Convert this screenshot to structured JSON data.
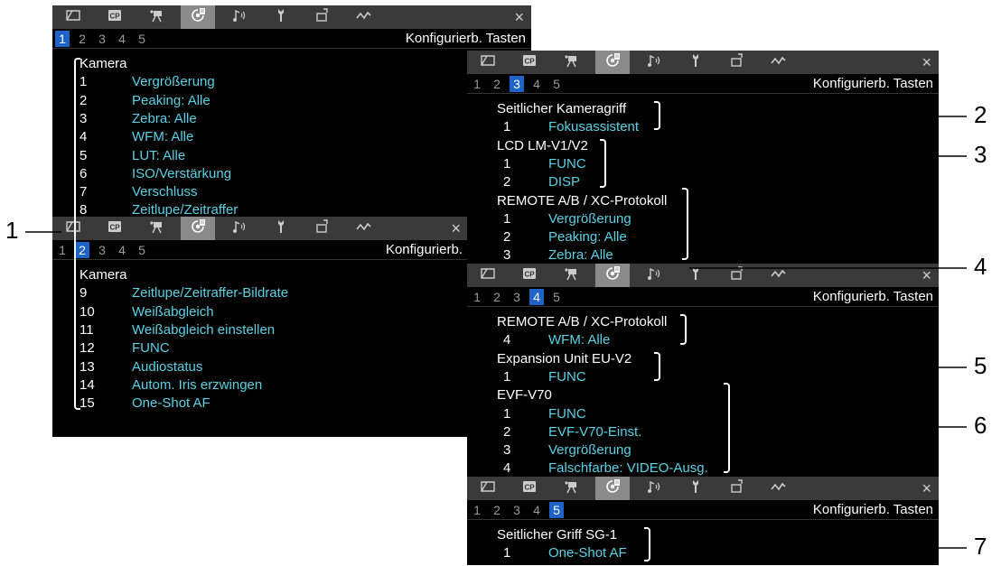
{
  "panels": [
    {
      "pages": [
        "1",
        "2",
        "3",
        "4",
        "5"
      ],
      "active_page": "1",
      "title": "Konfigurierb. Tasten",
      "groups": [
        {
          "name": "Kamera",
          "items": [
            {
              "num": "1",
              "label": "Vergrößerung"
            },
            {
              "num": "2",
              "label": "Peaking: Alle"
            },
            {
              "num": "3",
              "label": "Zebra: Alle"
            },
            {
              "num": "4",
              "label": "WFM: Alle"
            },
            {
              "num": "5",
              "label": "LUT: Alle"
            },
            {
              "num": "6",
              "label": "ISO/Verstärkung"
            },
            {
              "num": "7",
              "label": "Verschluss"
            },
            {
              "num": "8",
              "label": "Zeitlupe/Zeitraffer"
            }
          ]
        }
      ]
    },
    {
      "pages": [
        "1",
        "2",
        "3",
        "4",
        "5"
      ],
      "active_page": "2",
      "title": "Konfigurierb.",
      "groups": [
        {
          "name": "Kamera",
          "items": [
            {
              "num": "9",
              "label": "Zeitlupe/Zeitraffer-Bildrate"
            },
            {
              "num": "10",
              "label": "Weißabgleich"
            },
            {
              "num": "11",
              "label": "Weißabgleich einstellen"
            },
            {
              "num": "12",
              "label": "FUNC"
            },
            {
              "num": "13",
              "label": "Audiostatus"
            },
            {
              "num": "14",
              "label": "Autom. Iris erzwingen"
            },
            {
              "num": "15",
              "label": "One-Shot AF"
            }
          ]
        }
      ]
    },
    {
      "pages": [
        "1",
        "2",
        "3",
        "4",
        "5"
      ],
      "active_page": "3",
      "title": "Konfigurierb. Tasten",
      "groups": [
        {
          "name": "Seitlicher Kameragriff",
          "items": [
            {
              "num": "1",
              "label": "Fokusassistent"
            }
          ]
        },
        {
          "name": "LCD LM-V1/V2",
          "items": [
            {
              "num": "1",
              "label": "FUNC"
            },
            {
              "num": "2",
              "label": "DISP"
            }
          ]
        },
        {
          "name": "REMOTE A/B / XC-Protokoll",
          "items": [
            {
              "num": "1",
              "label": "Vergrößerung"
            },
            {
              "num": "2",
              "label": "Peaking: Alle"
            },
            {
              "num": "3",
              "label": "Zebra: Alle"
            }
          ]
        }
      ]
    },
    {
      "pages": [
        "1",
        "2",
        "3",
        "4",
        "5"
      ],
      "active_page": "4",
      "title": "Konfigurierb. Tasten",
      "groups": [
        {
          "name": "REMOTE A/B / XC-Protokoll",
          "items": [
            {
              "num": "4",
              "label": "WFM: Alle"
            }
          ]
        },
        {
          "name": "Expansion Unit EU-V2",
          "items": [
            {
              "num": "1",
              "label": "FUNC"
            }
          ]
        },
        {
          "name": "EVF-V70",
          "items": [
            {
              "num": "1",
              "label": "FUNC"
            },
            {
              "num": "2",
              "label": "EVF-V70-Einst."
            },
            {
              "num": "3",
              "label": "Vergrößerung"
            },
            {
              "num": "4",
              "label": "Falschfarbe: VIDEO-Ausg."
            }
          ]
        }
      ]
    },
    {
      "pages": [
        "1",
        "2",
        "3",
        "4",
        "5"
      ],
      "active_page": "5",
      "title": "Konfigurierb. Tasten",
      "groups": [
        {
          "name": "Seitlicher Griff SG-1",
          "items": [
            {
              "num": "1",
              "label": "One-Shot AF"
            }
          ]
        }
      ]
    }
  ],
  "tab_icons": [
    "lcd-screen-icon",
    "custom-picture-icon",
    "camera-recording-icon",
    "custom-function-icon",
    "audio-icon",
    "wrench-icon",
    "output-icon",
    "network-icon"
  ],
  "active_tab_icon": "custom-function-icon",
  "close_glyph": "×",
  "callouts": [
    "1",
    "2",
    "3",
    "4",
    "5",
    "6",
    "7"
  ],
  "colors": {
    "panel_bg": "#000000",
    "tabbar_bg": "#3a3a3a",
    "active_tab_bg": "#8a8a8a",
    "page_active_bg": "#1e64c8",
    "value_text": "#5ad2e6"
  }
}
